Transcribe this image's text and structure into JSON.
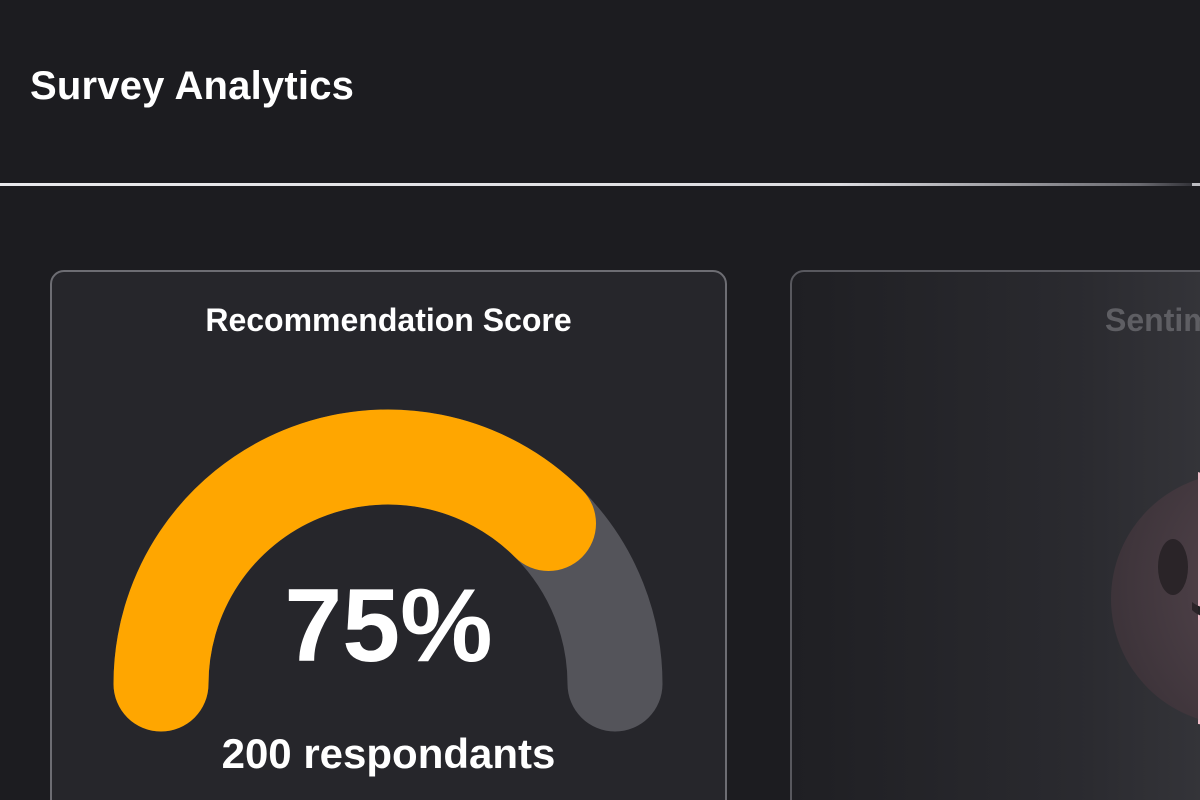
{
  "header": {
    "title": "Survey Analytics"
  },
  "score_card": {
    "title": "Recommendation Score",
    "value_label": "75%",
    "value_fraction": 0.75,
    "respondents_label": "200 respondants",
    "colors": {
      "filled": "#ffa600",
      "track": "#54545a"
    }
  },
  "sentiment_card": {
    "title_visible": "Sentim",
    "icon": "smiley-face-icon",
    "colors": {
      "face": "#4a3f45",
      "accent": "#f4c1cd"
    }
  }
}
